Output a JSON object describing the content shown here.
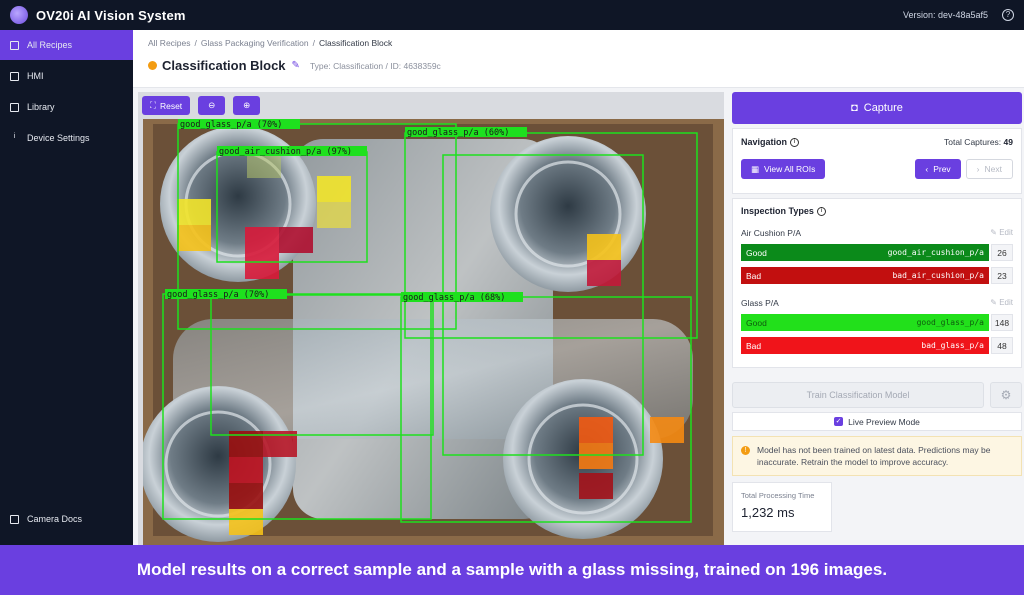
{
  "app": {
    "title": "OV20i AI Vision System",
    "version": "Version: dev-48a5af5"
  },
  "sidebar": {
    "items": [
      {
        "label": "All Recipes",
        "icon": "document-icon",
        "active": true
      },
      {
        "label": "HMI",
        "icon": "monitor-icon"
      },
      {
        "label": "Library",
        "icon": "grid-icon"
      },
      {
        "label": "Device Settings",
        "icon": "info-icon"
      }
    ],
    "bottom": {
      "label": "Camera Docs",
      "icon": "doc-icon"
    }
  },
  "breadcrumb": {
    "root": "All Recipes",
    "mid": "Glass Packaging Verification",
    "current": "Classification Block"
  },
  "page": {
    "title": "Classification Block",
    "meta": "Type: Classification / ID: 4638359c"
  },
  "toolbar": {
    "reset": "Reset"
  },
  "detections": [
    {
      "label": "good_glass_p/a (70%)"
    },
    {
      "label": "good_air_cushion_p/a (97%)"
    },
    {
      "label": "good_glass_p/a (60%)"
    },
    {
      "label": "good_glass_p/a (70%)"
    },
    {
      "label": "good_glass_p/a (68%)"
    }
  ],
  "panel": {
    "capture": "Capture",
    "navigation": "Navigation",
    "total_captures_label": "Total Captures:",
    "total_captures": "49",
    "view_all": "View All ROIs",
    "prev": "Prev",
    "next": "Next",
    "inspection_types": "Inspection Types",
    "edit": "Edit",
    "groups": [
      {
        "title": "Air Cushion P/A",
        "rows": [
          {
            "label": "Good",
            "cls": "good_air_cushion_p/a",
            "count": "26",
            "color": "#0b8a1a"
          },
          {
            "label": "Bad",
            "cls": "bad_air_cushion_p/a",
            "count": "23",
            "color": "#c20f0f"
          }
        ]
      },
      {
        "title": "Glass P/A",
        "rows": [
          {
            "label": "Good",
            "cls": "good_glass_p/a",
            "count": "148",
            "color": "#22e01b"
          },
          {
            "label": "Bad",
            "cls": "bad_glass_p/a",
            "count": "48",
            "color": "#f0141a"
          }
        ]
      }
    ],
    "train": "Train Classification Model",
    "live_preview": "Live Preview Mode",
    "warning": "Model has not been trained on latest data. Predictions may be inaccurate. Retrain the model to improve accuracy.",
    "processing_label": "Total Processing Time",
    "processing_value": "1,232 ms"
  },
  "caption": "Model results on a correct sample and a sample with a glass missing, trained on 196 images."
}
